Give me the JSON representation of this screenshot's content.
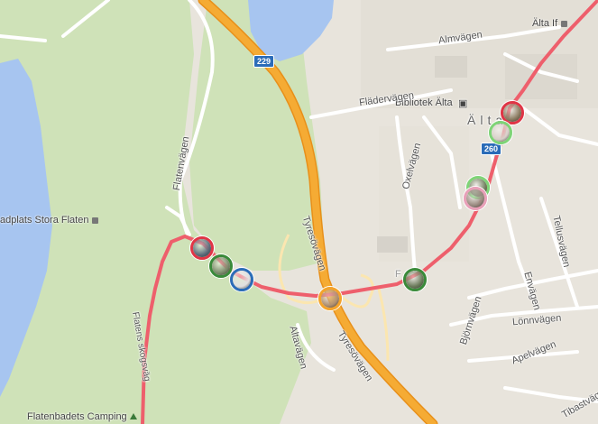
{
  "map": {
    "colors": {
      "land": "#e8e4dc",
      "water": "#a7c5f0",
      "park": "#cfe2b8",
      "motorway": "#f3a32b",
      "route": "#ee5f6c",
      "road": "#ffffff"
    },
    "road_labels": {
      "almvagen": "Almvägen",
      "fladervagen": "Flädervägen",
      "flatenvagen": "Flatenvägen",
      "oxelvagen": "Oxelvägen",
      "tyresovagen_upper": "Tyresövägen",
      "tyresovagen_lower": "Tyresövägen",
      "altavagen": "Altavägen",
      "bjornvagen": "Björnvägen",
      "lonnvagen": "Lönnvägen",
      "envagen": "Envägen",
      "tellusvagen": "Tellusvägen",
      "apelvagen": "Apelvägen",
      "tibastvagen": "Tibastvägen",
      "flatens_skogsvag": "Flatens skogsväg",
      "fr_n": "F"
    },
    "place_labels": {
      "alta_area": "Älta",
      "alta_if": "Älta If",
      "bibliotek_alta": "Bibliotek Älta",
      "badplats": "adplats Stora Flaten",
      "camping": "Flatenbadets Camping"
    },
    "shields": {
      "road_229": "229",
      "road_260": "260"
    },
    "markers": [
      {
        "name": "marker-photo-1",
        "ring": "#e03546",
        "fill": "#8a7a60"
      },
      {
        "name": "marker-photo-2",
        "ring": "#7fd477",
        "fill": "#d8cfc8"
      },
      {
        "name": "marker-photo-3",
        "ring": "#7fd477",
        "fill": "#6f7f5e"
      },
      {
        "name": "marker-photo-4",
        "ring": "#e8a0b8",
        "fill": "#9a8a80"
      },
      {
        "name": "marker-photo-5",
        "ring": "#e03546",
        "fill": "#5a6a7a"
      },
      {
        "name": "marker-photo-6",
        "ring": "#3a8a3a",
        "fill": "#7a8a6a"
      },
      {
        "name": "marker-photo-7",
        "ring": "#2b6cb8",
        "fill": "#e0e0e0"
      },
      {
        "name": "marker-photo-8",
        "ring": "#f3a32b",
        "fill": "#b09070"
      },
      {
        "name": "marker-photo-9",
        "ring": "#3a8a3a",
        "fill": "#6a7a5a"
      }
    ]
  }
}
